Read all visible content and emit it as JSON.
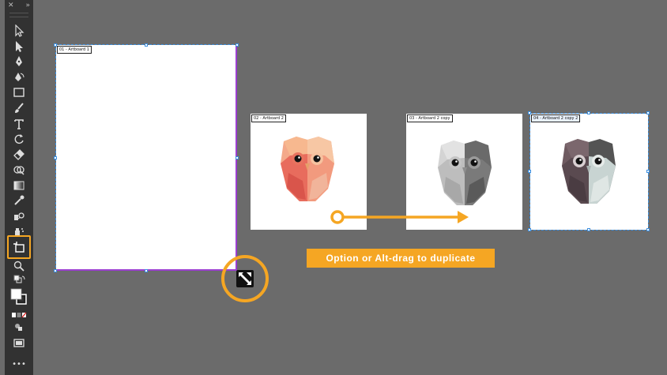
{
  "toolbar": {
    "close_glyph": "✕",
    "collapse_glyph": "»",
    "more_glyph": "•••",
    "tools": [
      "selection-tool",
      "direct-selection-tool",
      "pen-tool",
      "curvature-tool",
      "rectangle-tool",
      "paintbrush-tool",
      "type-tool",
      "rotate-tool",
      "eraser-tool",
      "shape-builder-tool",
      "gradient-tool",
      "eyedropper-tool",
      "blend-tool",
      "symbol-sprayer-tool",
      "artboard-tool",
      "zoom-tool"
    ],
    "active_tool": "artboard-tool"
  },
  "artboards": [
    {
      "label": "01 - Artboard 1"
    },
    {
      "label": "02 - Artboard 2"
    },
    {
      "label": "03 - Artboard 2 copy"
    },
    {
      "label": "04 - Artboard 2 copy 2"
    }
  ],
  "annotation": {
    "tooltip_text": "Option or Alt-drag to duplicate",
    "accent_color": "#f5a623"
  },
  "colors": {
    "canvas": "#6b6b6b",
    "toolbar": "#323232",
    "selection": "#3b8fe0",
    "artboard1_edge": "#9b3fd0"
  }
}
